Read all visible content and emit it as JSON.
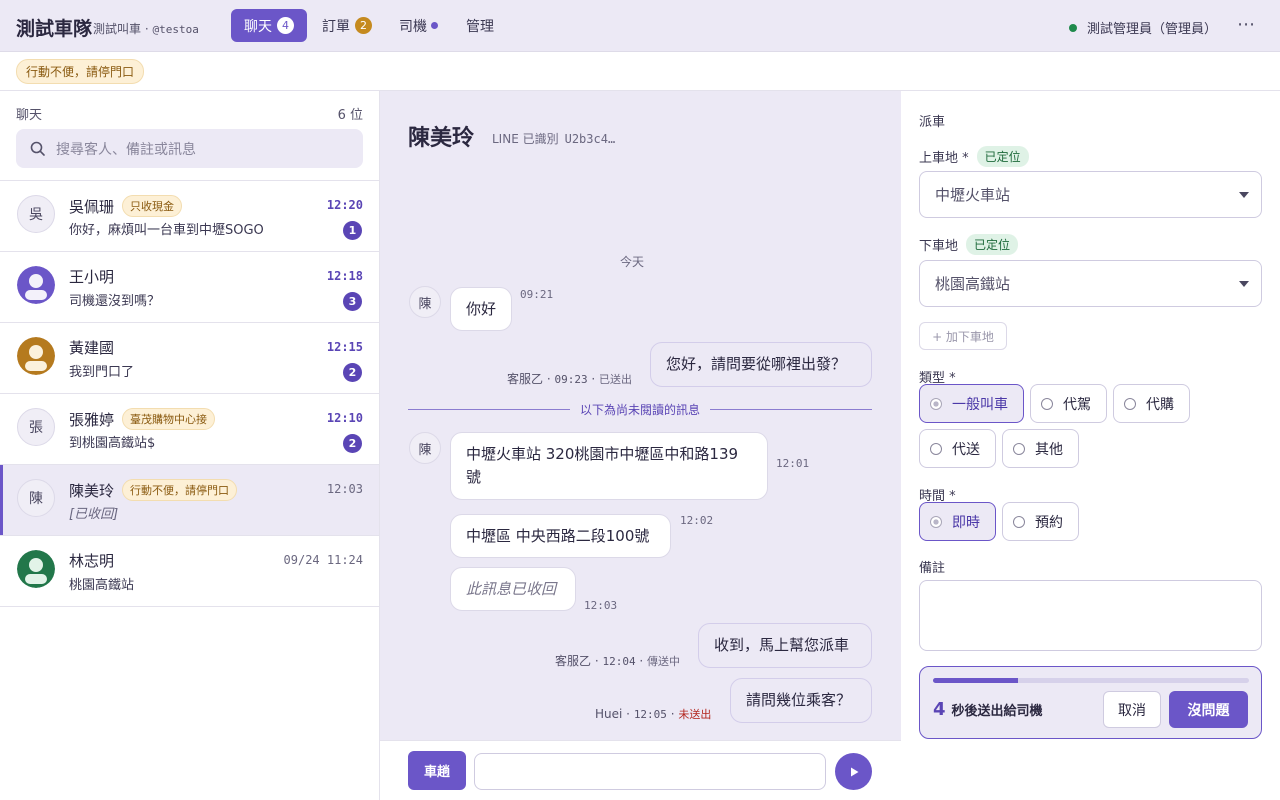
{
  "brand": {
    "title": "測試車隊",
    "subtitle": "測試叫車 · ",
    "handle": "@testoa"
  },
  "nav": {
    "tabs": [
      {
        "label": "聊天",
        "badge": "4"
      },
      {
        "label": "訂單",
        "badge": "2"
      },
      {
        "label": "司機"
      },
      {
        "label": "管理"
      }
    ]
  },
  "user": {
    "name": "測試管理員（管理員）",
    "status_color": "#1f8a4c"
  },
  "notebar": {
    "pill": "行動不便，請停門口"
  },
  "sidebar": {
    "title": "聊天",
    "count": "6 位",
    "search_placeholder": "搜尋客人、備註或訊息",
    "conversations": [
      {
        "avatar": "吳",
        "name": "吳佩珊",
        "tag": "只收現金",
        "message": "你好，麻煩叫一台車到中壢SOGO",
        "time": "12:20",
        "unread": "1"
      },
      {
        "avatar": "",
        "name": "王小明",
        "message": "司機還沒到嗎？",
        "time": "12:18",
        "unread": "3"
      },
      {
        "avatar": "",
        "name": "黃建國",
        "message": "我到門口了",
        "time": "12:15",
        "unread": "2"
      },
      {
        "avatar": "張",
        "name": "張雅婷",
        "tag": "臺茂購物中心接",
        "message": "到桃園高鐵站$",
        "time": "12:10",
        "unread": "2"
      },
      {
        "avatar": "陳",
        "name": "陳美玲",
        "tag": "行動不便，請停門口",
        "message": "[已收回]",
        "time": "12:03"
      },
      {
        "avatar": "",
        "name": "林志明",
        "message": "桃園高鐵站",
        "time": "09/24 11:24"
      }
    ]
  },
  "chat": {
    "title": "陳美玲",
    "subtitle": "LINE 已識別",
    "line_id": "U2b3c4…",
    "day": "今天",
    "avatar": "陳",
    "unread_divider": "以下為尚未閱讀的訊息",
    "messages": [
      {
        "dir": "in",
        "text": "你好",
        "time": "09:21"
      },
      {
        "dir": "out",
        "text": "您好，請問要從哪裡出發？",
        "sender": "客服乙",
        "time": "09:23",
        "status": "已送出"
      },
      {
        "dir": "in",
        "text": "中壢火車站 320桃園市中壢區中和路139號",
        "time": "12:01"
      },
      {
        "dir": "in",
        "text": "中壢區 中央西路二段100號",
        "time": "12:02"
      },
      {
        "dir": "in",
        "text": "此訊息已收回",
        "time": "12:03"
      },
      {
        "dir": "out",
        "text": "收到，馬上幫您派車",
        "sender": "客服乙",
        "time": "12:04",
        "status": "傳送中"
      },
      {
        "dir": "out",
        "text": "請問幾位乘客？",
        "sender": "Huei",
        "time": "12:05",
        "status": "未送出"
      }
    ],
    "composer": {
      "quick_button": "車趟",
      "input_value": ""
    }
  },
  "dispatch": {
    "title": "派車",
    "pickup_label": "上車地 *",
    "pickup_status": "已定位",
    "pickup_value": "中壢火車站",
    "dropoff_label": "下車地",
    "dropoff_status": "已定位",
    "dropoff_value": "桃園高鐵站",
    "add_dropoff": "+ 加下車地",
    "type_label": "類型 *",
    "types": [
      "一般叫車",
      "代駕",
      "代購",
      "代送",
      "其他"
    ],
    "type_selected": "一般叫車",
    "time_label": "時間 *",
    "times": [
      "即時",
      "預約"
    ],
    "time_selected": "即時",
    "note_label": "備註",
    "note_value": "",
    "countdown": {
      "seconds": "4",
      "text": "秒後送出給司機",
      "progress": 0.27,
      "cancel": "取消",
      "confirm": "沒問題"
    }
  },
  "colors": {
    "accent": "#6b56c8",
    "tag_bg": "#fdf0d6",
    "ok_bg": "#dff2e6",
    "fail": "#b3261e"
  }
}
